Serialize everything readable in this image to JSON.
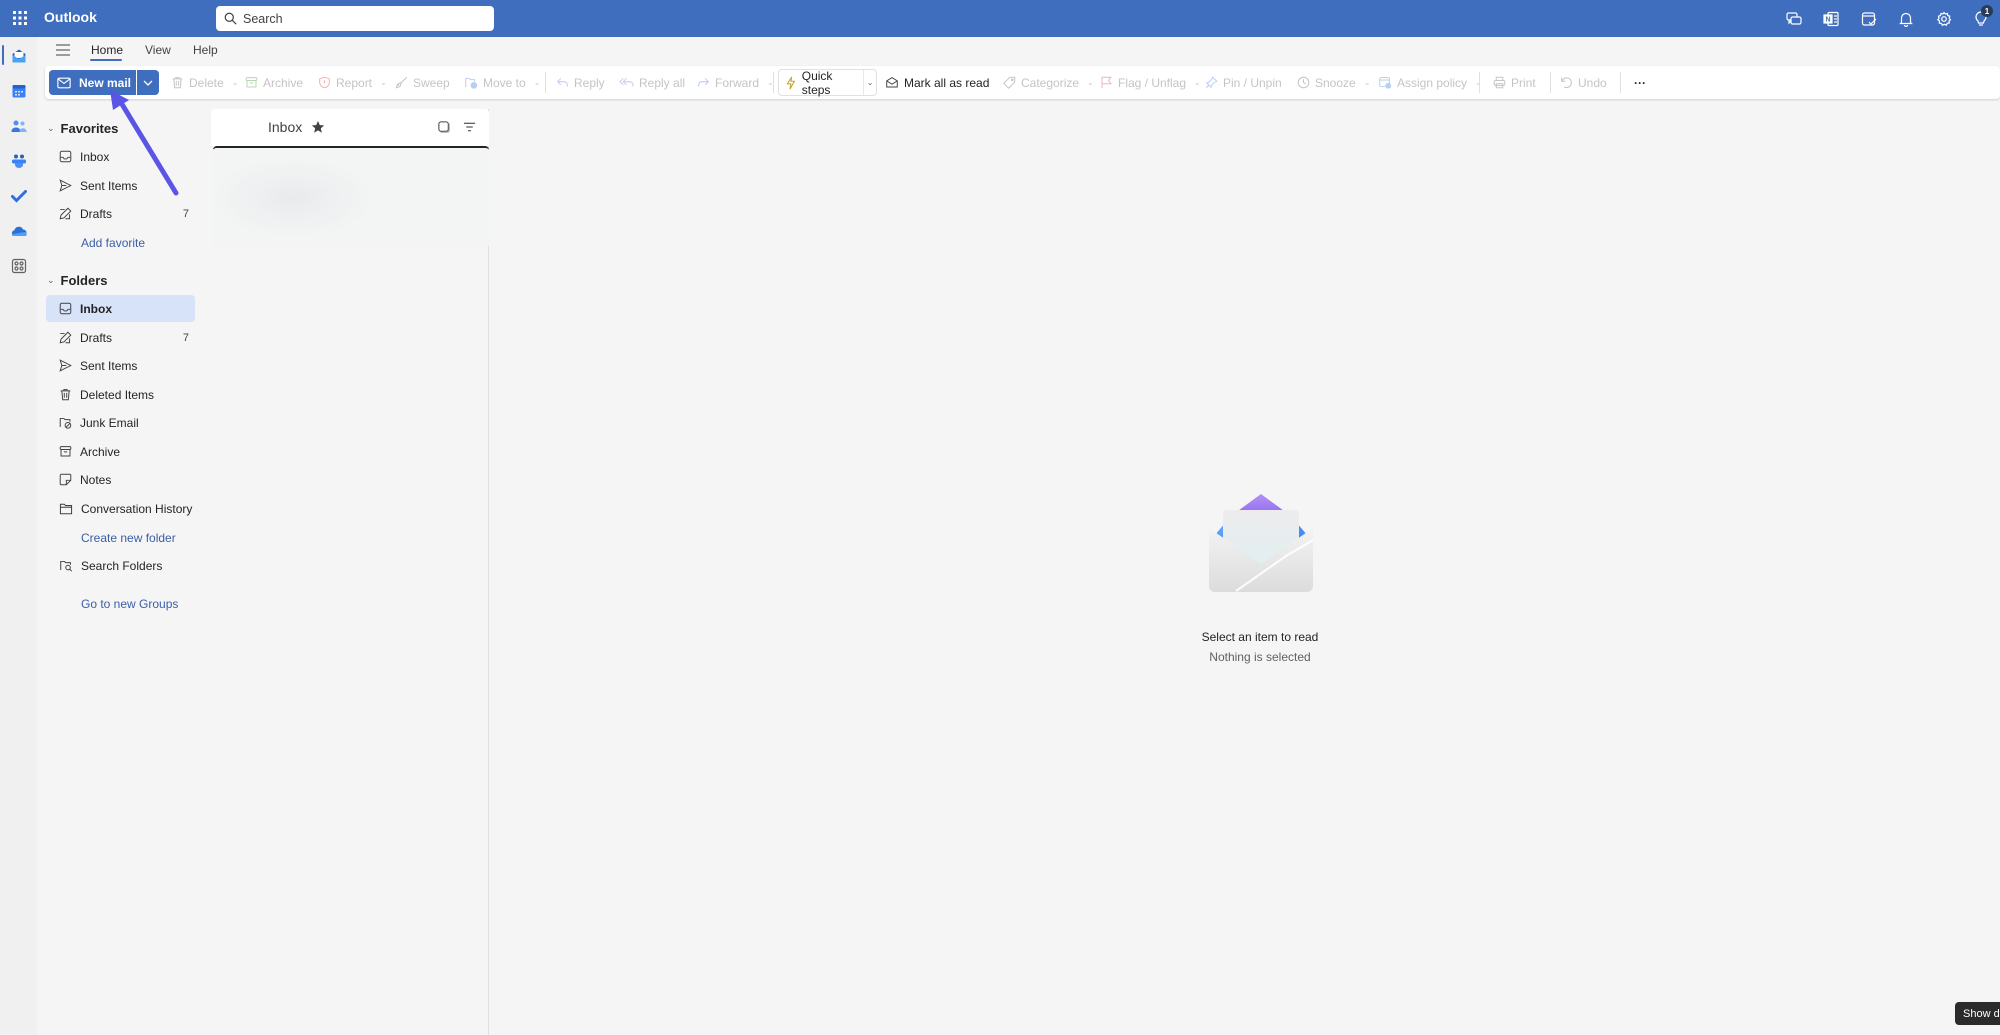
{
  "app": {
    "title": "Outlook",
    "accent_color": "#3f6ebf"
  },
  "search": {
    "placeholder": "Search",
    "icon": "search-icon"
  },
  "top_icons": [
    {
      "name": "teams-chat-icon"
    },
    {
      "name": "onenote-icon"
    },
    {
      "name": "my-day-icon"
    },
    {
      "name": "notifications-bell-icon"
    },
    {
      "name": "settings-gear-icon"
    },
    {
      "name": "tips-lightbulb-icon",
      "badge": "1"
    }
  ],
  "rail": [
    {
      "name": "mail-app-icon",
      "active": true
    },
    {
      "name": "calendar-app-icon"
    },
    {
      "name": "people-app-icon"
    },
    {
      "name": "groups-app-icon"
    },
    {
      "name": "todo-app-icon"
    },
    {
      "name": "onedrive-app-icon"
    },
    {
      "name": "more-apps-icon"
    }
  ],
  "ribbon": {
    "tabs": [
      "Home",
      "View",
      "Help"
    ],
    "active_tab": "Home"
  },
  "toolbar": {
    "new_mail": "New mail",
    "delete": "Delete",
    "archive": "Archive",
    "report": "Report",
    "sweep": "Sweep",
    "move_to": "Move to",
    "reply": "Reply",
    "reply_all": "Reply all",
    "forward": "Forward",
    "quick_steps": "Quick steps",
    "mark_all_read": "Mark all as read",
    "categorize": "Categorize",
    "flag": "Flag / Unflag",
    "pin": "Pin / Unpin",
    "snooze": "Snooze",
    "assign_policy": "Assign policy",
    "print": "Print",
    "undo": "Undo",
    "more": "···"
  },
  "favorites": {
    "header": "Favorites",
    "items": [
      {
        "label": "Inbox",
        "icon": "inbox-icon"
      },
      {
        "label": "Sent Items",
        "icon": "sent-icon"
      },
      {
        "label": "Drafts",
        "icon": "drafts-icon",
        "count": "7"
      }
    ],
    "add_link": "Add favorite"
  },
  "folders": {
    "header": "Folders",
    "items": [
      {
        "label": "Inbox",
        "icon": "inbox-icon",
        "selected": true
      },
      {
        "label": "Drafts",
        "icon": "drafts-icon",
        "count": "7"
      },
      {
        "label": "Sent Items",
        "icon": "sent-icon"
      },
      {
        "label": "Deleted Items",
        "icon": "trash-icon"
      },
      {
        "label": "Junk Email",
        "icon": "junk-icon"
      },
      {
        "label": "Archive",
        "icon": "archive-icon"
      },
      {
        "label": "Notes",
        "icon": "notes-icon"
      },
      {
        "label": "Conversation History",
        "icon": "folder-icon"
      }
    ],
    "create_link": "Create new folder",
    "search_folders": "Search Folders",
    "groups_link": "Go to new Groups"
  },
  "message_list": {
    "title": "Inbox"
  },
  "reading_pane": {
    "empty_title": "Select an item to read",
    "empty_subtitle": "Nothing is selected"
  },
  "tooltip": {
    "text": "Show de"
  }
}
